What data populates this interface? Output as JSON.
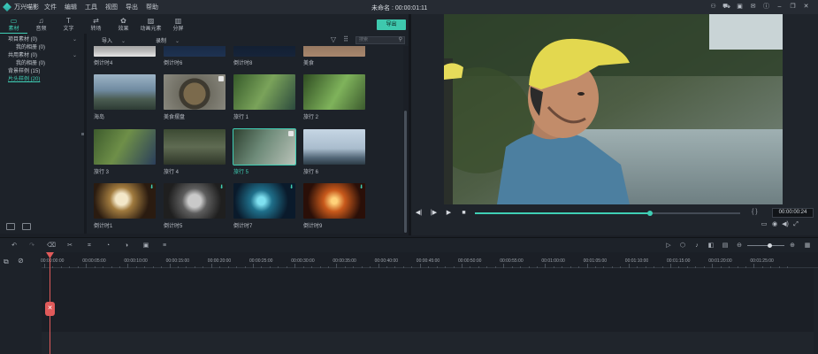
{
  "app": {
    "name": "万兴喵影",
    "menu": [
      "文件",
      "编辑",
      "工具",
      "视图",
      "导出",
      "帮助"
    ],
    "doc_title": "未命名 : 00:00:01:11"
  },
  "tool_tabs": [
    {
      "icon": "folder-icon",
      "label": "素材",
      "active": true
    },
    {
      "icon": "music-icon",
      "label": "音频",
      "active": false
    },
    {
      "icon": "text-icon",
      "label": "文字",
      "active": false
    },
    {
      "icon": "transition-icon",
      "label": "转场",
      "active": false
    },
    {
      "icon": "effects-icon",
      "label": "效果",
      "active": false
    },
    {
      "icon": "elements-icon",
      "label": "动画元素",
      "active": false
    },
    {
      "icon": "split-screen-icon",
      "label": "分屏",
      "active": false
    }
  ],
  "export_label": "导出",
  "tree": [
    {
      "label": "项目素材 (0)",
      "level": "top",
      "chevron": true
    },
    {
      "label": "我的相册 (0)",
      "level": "sub"
    },
    {
      "label": "共用素材 (0)",
      "level": "top",
      "chevron": true
    },
    {
      "label": "我的相册 (0)",
      "level": "sub"
    },
    {
      "label": "背景样例 (15)",
      "level": "top"
    },
    {
      "label": "片头样例 (20)",
      "level": "top",
      "active": true
    }
  ],
  "media_bar": {
    "import_label": "导入",
    "record_label": "录制",
    "search_placeholder": "搜索"
  },
  "media": [
    {
      "caption": "倒计时4"
    },
    {
      "caption": "倒计时6"
    },
    {
      "caption": "倒计时8"
    },
    {
      "caption": "美食"
    },
    {
      "caption": "海岛"
    },
    {
      "caption": "美食摆盘"
    },
    {
      "caption": "旅行 1"
    },
    {
      "caption": "旅行 2"
    },
    {
      "caption": "旅行 3"
    },
    {
      "caption": "旅行 4"
    },
    {
      "caption": "旅行 5"
    },
    {
      "caption": "旅行 6"
    },
    {
      "caption": "倒计时1"
    },
    {
      "caption": "倒计时5"
    },
    {
      "caption": "倒计时7"
    },
    {
      "caption": "倒计时9"
    }
  ],
  "preview": {
    "timecode": "00:00:00:24",
    "progress": 0.66,
    "brackets": "{ }"
  },
  "timeline": {
    "ticks": [
      "00:00:00:00",
      "00:00:05:00",
      "00:00:10:00",
      "00:00:15:00",
      "00:00:20:00",
      "00:00:25:00",
      "00:00:30:00",
      "00:00:35:00",
      "00:00:40:00",
      "00:00:45:00",
      "00:00:50:00",
      "00:00:55:00",
      "00:01:00:00",
      "00:01:05:00",
      "00:01:10:00",
      "00:01:15:00",
      "00:01:20:00",
      "00:01:25:00"
    ],
    "zoom": 0.6
  },
  "colors": {
    "accent": "#3fcfb5",
    "playhead": "#e05a5a"
  }
}
